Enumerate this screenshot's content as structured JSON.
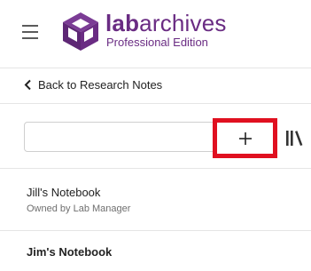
{
  "header": {
    "brand_prefix": "lab",
    "brand_suffix": "archives",
    "edition": "Professional Edition",
    "menu_icon": "hamburger-menu-icon",
    "logo_icon": "labarchives-cube-icon",
    "brand_color": "#6a2c83"
  },
  "navigation": {
    "back_label": "Back to Research Notes",
    "back_icon": "chevron-left-icon"
  },
  "toolbar": {
    "search_value": "",
    "add_label": "+",
    "add_icon": "plus-icon",
    "highlight_color": "#e01020",
    "library_icon": "library-books-icon"
  },
  "notebooks": [
    {
      "title": "Jill's Notebook",
      "owner": "Owned by Lab Manager"
    },
    {
      "title": "Jim's Notebook"
    }
  ]
}
